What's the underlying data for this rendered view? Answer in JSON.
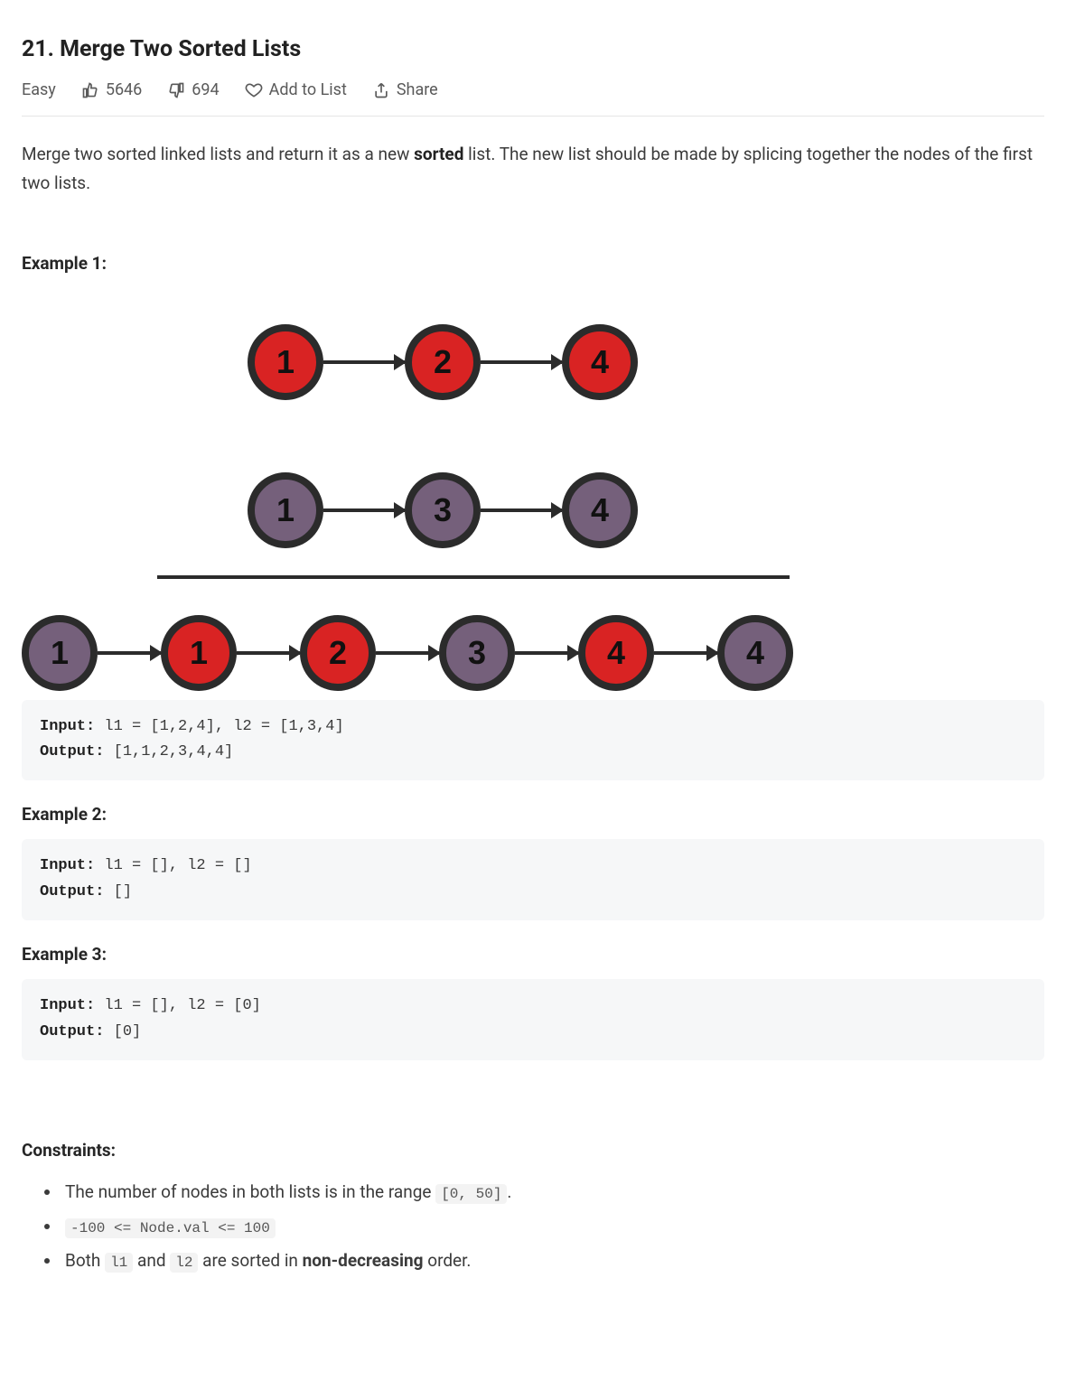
{
  "title": "21. Merge Two Sorted Lists",
  "meta": {
    "difficulty": "Easy",
    "likes": "5646",
    "dislikes": "694",
    "add_to_list": "Add to List",
    "share": "Share"
  },
  "description": {
    "pre": "Merge two sorted linked lists and return it as a new ",
    "bold": "sorted",
    "post": " list. The new list should be made by splicing together the nodes of the first two lists."
  },
  "example1_label": "Example 1:",
  "example2_label": "Example 2:",
  "example3_label": "Example 3:",
  "diagram": {
    "list1": [
      {
        "value": "1",
        "color": "red"
      },
      {
        "value": "2",
        "color": "red"
      },
      {
        "value": "4",
        "color": "red"
      }
    ],
    "list2": [
      {
        "value": "1",
        "color": "purple"
      },
      {
        "value": "3",
        "color": "purple"
      },
      {
        "value": "4",
        "color": "purple"
      }
    ],
    "merged": [
      {
        "value": "1",
        "color": "purple"
      },
      {
        "value": "1",
        "color": "red"
      },
      {
        "value": "2",
        "color": "red"
      },
      {
        "value": "3",
        "color": "purple"
      },
      {
        "value": "4",
        "color": "red"
      },
      {
        "value": "4",
        "color": "purple"
      }
    ]
  },
  "example1": {
    "input_label": "Input:",
    "input_value": " l1 = [1,2,4], l2 = [1,3,4]",
    "output_label": "Output:",
    "output_value": " [1,1,2,3,4,4]"
  },
  "example2": {
    "input_label": "Input:",
    "input_value": " l1 = [], l2 = []",
    "output_label": "Output:",
    "output_value": " []"
  },
  "example3": {
    "input_label": "Input:",
    "input_value": " l1 = [], l2 = [0]",
    "output_label": "Output:",
    "output_value": " [0]"
  },
  "constraints_label": "Constraints:",
  "constraints": {
    "c1_pre": "The number of nodes in both lists is in the range ",
    "c1_code": "[0, 50]",
    "c1_post": ".",
    "c2_code": "-100 <= Node.val <= 100",
    "c3_pre": "Both ",
    "c3_code1": "l1",
    "c3_mid": " and ",
    "c3_code2": "l2",
    "c3_post1": " are sorted in ",
    "c3_bold": "non-decreasing",
    "c3_post2": " order."
  }
}
